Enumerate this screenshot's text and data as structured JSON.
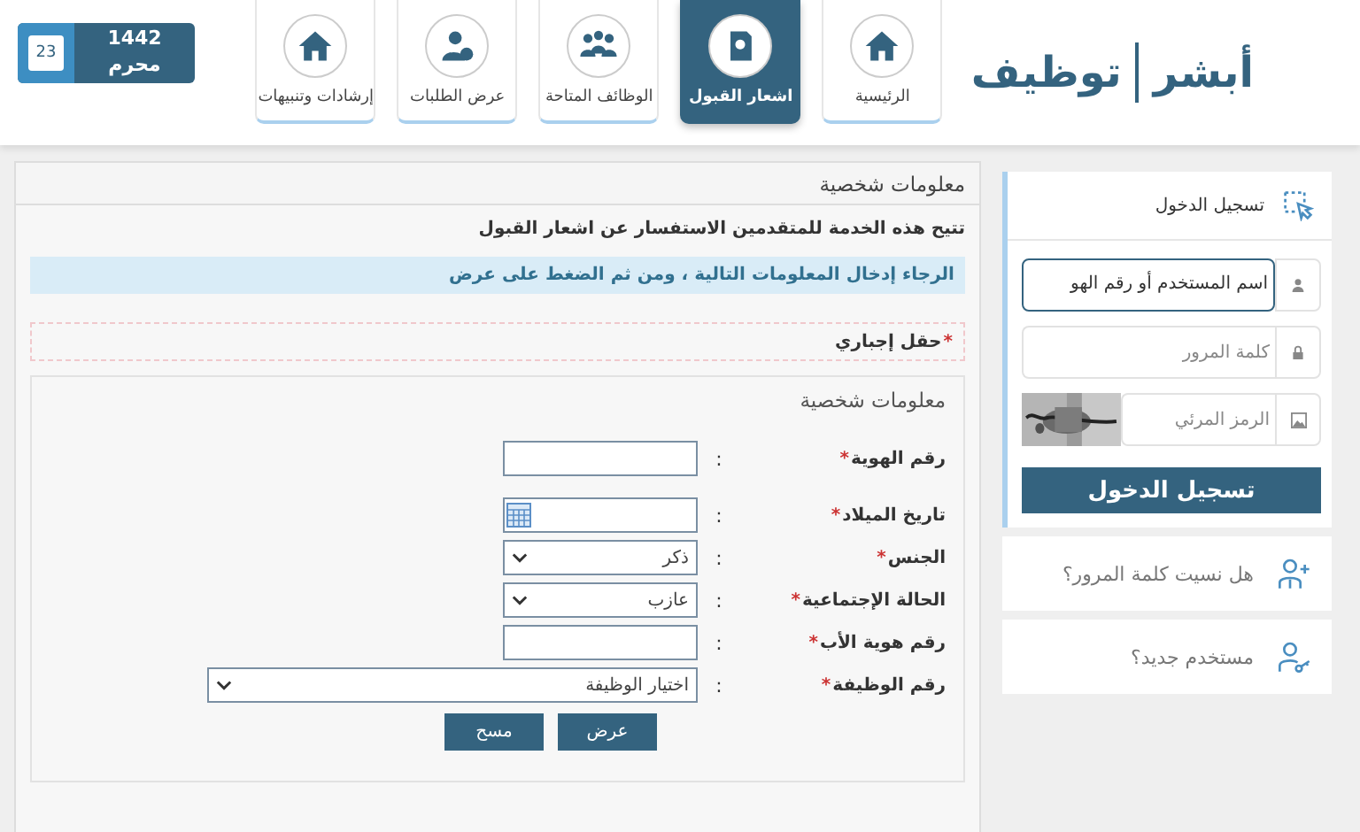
{
  "logo": {
    "part_1": "أبشر",
    "part_2": "توظيف"
  },
  "nav": [
    {
      "label": "الرئيسية",
      "kind": "home",
      "selected": false
    },
    {
      "label": "اشعار القبول",
      "kind": "document",
      "selected": true
    },
    {
      "label": "الوظائف المتاحة",
      "kind": "group",
      "selected": false
    },
    {
      "label": "عرض الطلبات",
      "kind": "user",
      "selected": false
    },
    {
      "label": "إرشادات وتنبيهات",
      "kind": "home",
      "selected": false
    }
  ],
  "date": {
    "day": "23",
    "year": "1442",
    "month": "محرم"
  },
  "main": {
    "title": "معلومات شخصية",
    "description": "تتيح هذه الخدمة للمتقدمين الاستفسار عن اشعار القبول",
    "info": "الرجاء إدخال المعلومات التالية ، ومن ثم الضغط على عرض",
    "required_note": {
      "mark": "*",
      "text": "حقل إجباري"
    },
    "fieldset": {
      "title": "معلومات شخصية",
      "fields": [
        {
          "label": "رقم الهوية",
          "mark": "*",
          "colon": ":",
          "kind": "text"
        },
        {
          "label": "تاريخ الميلاد",
          "mark": "*",
          "colon": ":",
          "kind": "date"
        },
        {
          "label": "الجنس",
          "mark": "*",
          "colon": ":",
          "kind": "select",
          "value": "ذكر"
        },
        {
          "label": "الحالة الإجتماعية",
          "mark": "*",
          "colon": ":",
          "kind": "select",
          "value": "عازب"
        },
        {
          "label": "رقم هوية الأب",
          "mark": "*",
          "colon": ":",
          "kind": "text"
        },
        {
          "label": "رقم الوظيفة",
          "mark": "*",
          "colon": ":",
          "kind": "wide-select",
          "value": "اختيار الوظيفة"
        }
      ]
    },
    "buttons": [
      "عرض",
      "مسح"
    ]
  },
  "login": {
    "title": "تسجيل الدخول",
    "fields": [
      {
        "kind": "user",
        "value": "اسم المستخدم أو رقم الهو",
        "focused": true
      },
      {
        "kind": "password",
        "placeholder": "كلمة المرور",
        "focused": false
      },
      {
        "kind": "captcha",
        "placeholder": "الرمز المرئي",
        "focused": false
      }
    ],
    "button": "تسجيل الدخول"
  },
  "links": [
    {
      "label": "هل نسيت كلمة المرور؟",
      "kind": "recover"
    },
    {
      "label": "مستخدم جديد؟",
      "kind": "register"
    }
  ]
}
